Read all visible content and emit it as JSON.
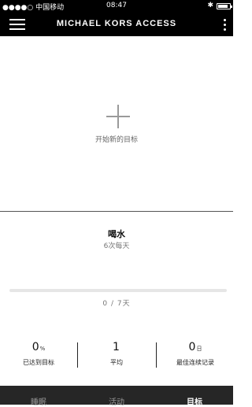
{
  "status_bar": {
    "carrier": "●●●●○ 中国移动",
    "time": "08:47"
  },
  "header": {
    "title": "MICHAEL KORS ACCESS"
  },
  "new_goal": {
    "label": "开始新的目标"
  },
  "goal": {
    "name": "喝水",
    "frequency": "6次每天",
    "progress_text": "0 / 7天",
    "progress_fraction": 0
  },
  "stats": [
    {
      "value": "0",
      "unit": "%",
      "label": "已达到目标"
    },
    {
      "value": "1",
      "unit": "",
      "label": "平均"
    },
    {
      "value": "0",
      "unit": "日",
      "label": "最佳连续记录"
    }
  ],
  "tabs": [
    {
      "label": "睡眠",
      "active": false
    },
    {
      "label": "活动",
      "active": false
    },
    {
      "label": "目标",
      "active": true
    }
  ],
  "icons": [
    "menu-icon",
    "more-vertical-icon",
    "plus-icon",
    "wifi-icon",
    "bluetooth-icon",
    "battery-icon"
  ]
}
